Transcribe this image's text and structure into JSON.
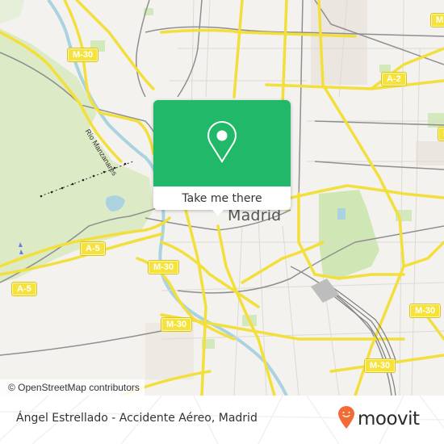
{
  "map": {
    "city_label": "Madrid",
    "river_label": "Río Manzanares",
    "road_shields": [
      {
        "id": "m30-nw",
        "label": "M-30"
      },
      {
        "id": "a2",
        "label": "A-2"
      },
      {
        "id": "m30-ne-edge",
        "label": "M"
      },
      {
        "id": "m30-e-edge",
        "label": "M"
      },
      {
        "id": "a5-center",
        "label": "A-5"
      },
      {
        "id": "a5-west",
        "label": "A-5"
      },
      {
        "id": "m30-center",
        "label": "M-30"
      },
      {
        "id": "m30-sw",
        "label": "M-30"
      },
      {
        "id": "m30-east",
        "label": "M-30"
      },
      {
        "id": "m30-se",
        "label": "M-30"
      }
    ],
    "attribution": "© OpenStreetMap contributors",
    "colors": {
      "background": "#f3f2ee",
      "park": "#d7ebc0",
      "major_road": "#f5e23a",
      "rail": "#8a8a8a",
      "water": "#aad3df"
    }
  },
  "popup": {
    "icon": "location-pin-icon",
    "action_label": "Take me there",
    "accent_color": "#21b86a"
  },
  "footer": {
    "place_name": "Ángel Estrellado - Accidente Aéreo, Madrid",
    "brand_name": "moovit",
    "brand_color": "#f26a36"
  }
}
